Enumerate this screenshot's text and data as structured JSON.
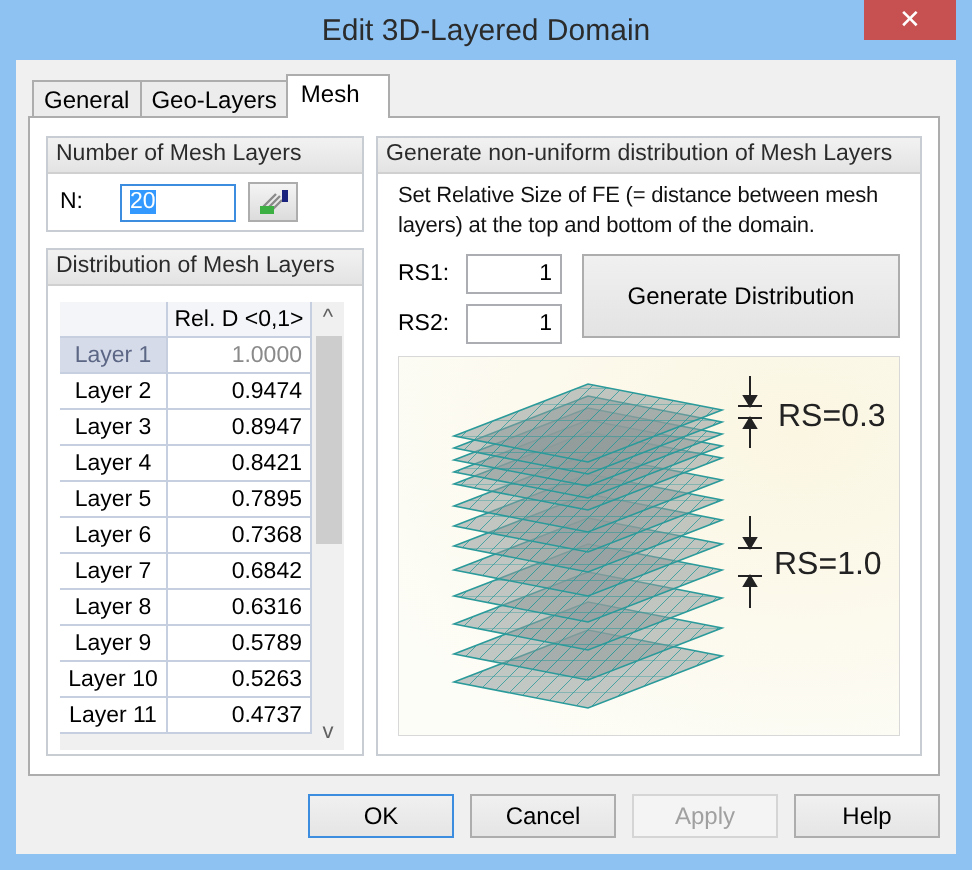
{
  "window": {
    "title": "Edit 3D-Layered Domain",
    "close": "✕"
  },
  "tabs": [
    {
      "label": "General",
      "selected": false
    },
    {
      "label": "Geo-Layers",
      "selected": false
    },
    {
      "label": "Mesh",
      "selected": true
    }
  ],
  "mesh_layers": {
    "title": "Number of Mesh Layers",
    "label": "N:",
    "value": "20",
    "text_selected": true
  },
  "distribution": {
    "title": "Distribution of Mesh Layers",
    "columns": [
      "Rel. D <0,1>"
    ],
    "rows": [
      {
        "label": "Layer 1",
        "value": "1.0000",
        "disabled": true
      },
      {
        "label": "Layer 2",
        "value": "0.9474",
        "disabled": false
      },
      {
        "label": "Layer 3",
        "value": "0.8947",
        "disabled": false
      },
      {
        "label": "Layer 4",
        "value": "0.8421",
        "disabled": false
      },
      {
        "label": "Layer 5",
        "value": "0.7895",
        "disabled": false
      },
      {
        "label": "Layer 6",
        "value": "0.7368",
        "disabled": false
      },
      {
        "label": "Layer 7",
        "value": "0.6842",
        "disabled": false
      },
      {
        "label": "Layer 8",
        "value": "0.6316",
        "disabled": false
      },
      {
        "label": "Layer 9",
        "value": "0.5789",
        "disabled": false
      },
      {
        "label": "Layer 10",
        "value": "0.5263",
        "disabled": false
      },
      {
        "label": "Layer 11",
        "value": "0.4737",
        "disabled": false
      }
    ],
    "scroll_up": "^",
    "scroll_down": "v"
  },
  "generate": {
    "title": "Generate non-uniform distribution of Mesh Layers",
    "description": "Set Relative Size of FE (= distance between mesh layers) at the top and bottom of the domain.",
    "fields": [
      {
        "label": "RS1:",
        "value": "1"
      },
      {
        "label": "RS2:",
        "value": "1"
      }
    ],
    "button": "Generate Distribution",
    "annotations": [
      "RS=0.3",
      "RS=1.0"
    ]
  },
  "buttons": [
    {
      "label": "OK",
      "default": true,
      "disabled": false
    },
    {
      "label": "Cancel",
      "default": false,
      "disabled": false
    },
    {
      "label": "Apply",
      "default": false,
      "disabled": true
    },
    {
      "label": "Help",
      "default": false,
      "disabled": false
    }
  ]
}
